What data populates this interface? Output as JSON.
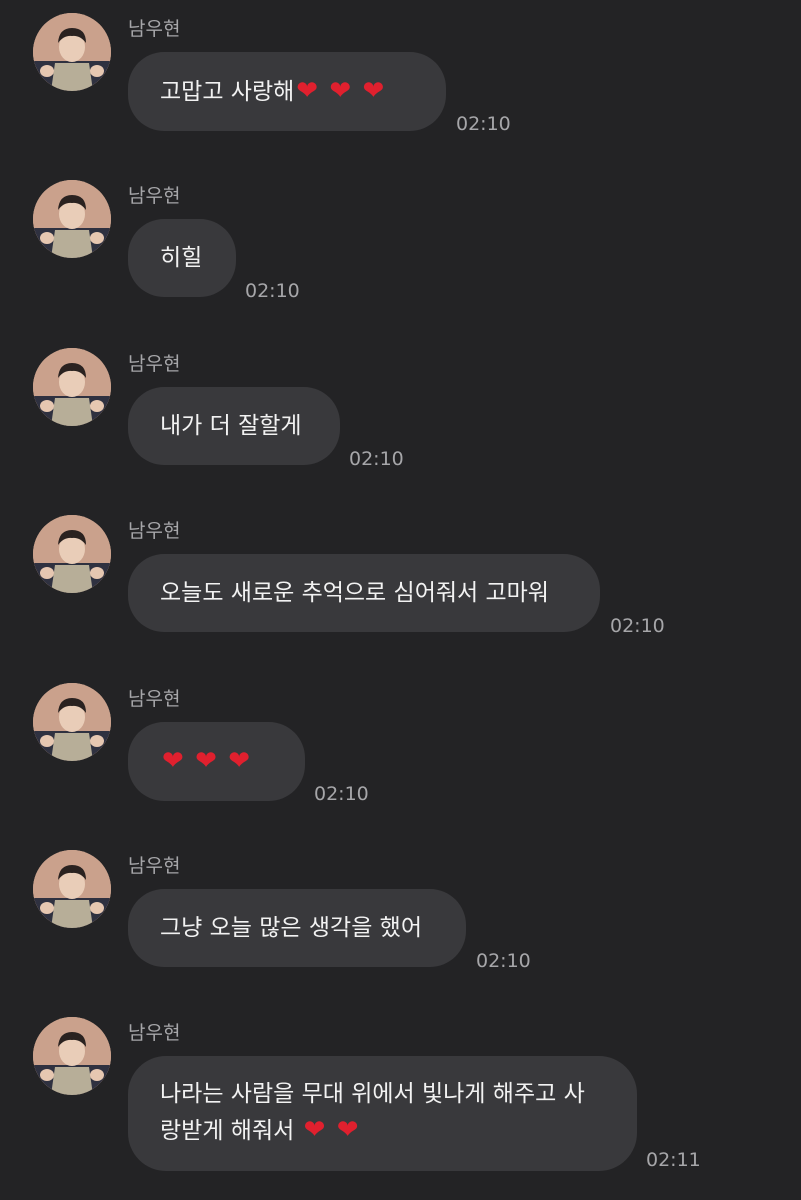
{
  "chat": {
    "messages": [
      {
        "sender": "남우현",
        "lines": [
          "고맙고 사랑해❤️ ❤️ ❤️"
        ],
        "time": "02:10"
      },
      {
        "sender": "남우현",
        "lines": [
          "히힐"
        ],
        "time": "02:10"
      },
      {
        "sender": "남우현",
        "lines": [
          "내가 더 잘할게"
        ],
        "time": "02:10"
      },
      {
        "sender": "남우현",
        "lines": [
          "오늘도 새로운 추억으로 심어줘서 고마워"
        ],
        "time": "02:10"
      },
      {
        "sender": "남우현",
        "lines": [
          "❤️ ❤️ ❤️"
        ],
        "time": "02:10"
      },
      {
        "sender": "남우현",
        "lines": [
          "그냥 오늘 많은 생각을 했어"
        ],
        "time": "02:10"
      },
      {
        "sender": "남우현",
        "lines": [
          "나라는 사람을 무대 위에서 빛나게 해주고 사",
          "랑받게 해줘서 ❤️ ❤️"
        ],
        "time": "02:11"
      }
    ]
  },
  "colors": {
    "background": "#232325",
    "bubble": "#39393c",
    "text": "#f2f2f2",
    "meta": "#a6a6a9",
    "heart": "#e0202e"
  },
  "icons": {
    "avatar": "profile-photo"
  }
}
